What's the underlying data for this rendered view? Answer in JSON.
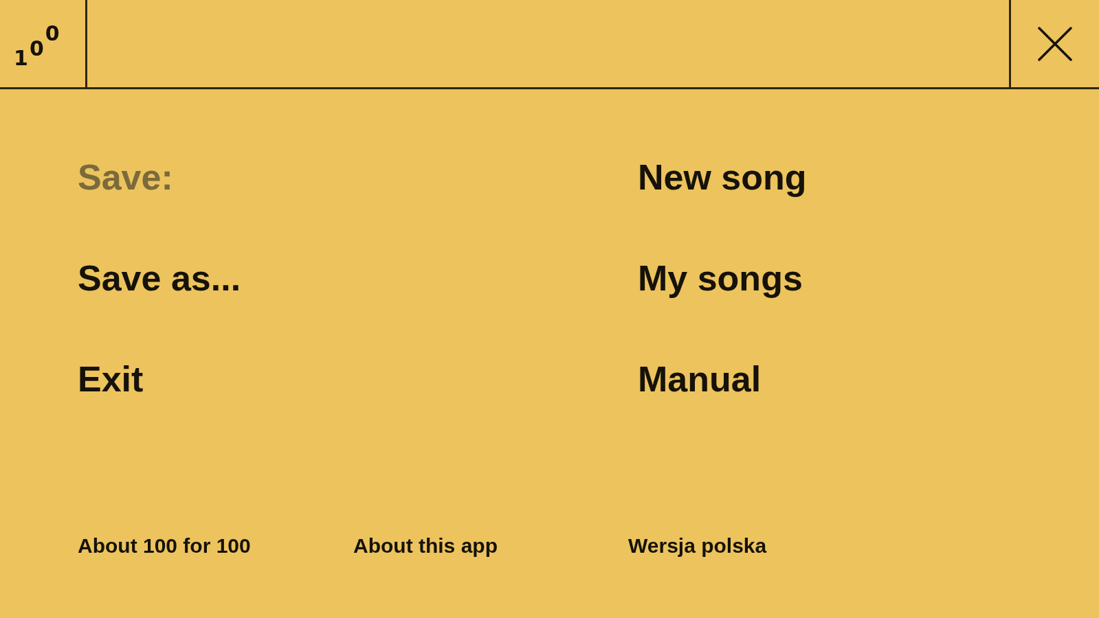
{
  "header": {
    "logo": "100"
  },
  "menu_columns": [
    {
      "items": [
        {
          "label": "Save:",
          "disabled": true
        },
        {
          "label": "Save as...",
          "disabled": false
        },
        {
          "label": "Exit",
          "disabled": false
        }
      ]
    },
    {
      "items": [
        {
          "label": "New song",
          "disabled": false
        },
        {
          "label": "My songs",
          "disabled": false
        },
        {
          "label": "Manual",
          "disabled": false
        }
      ]
    }
  ],
  "footer_links": [
    "About 100 for 100",
    "About this app",
    "Wersja polska"
  ]
}
